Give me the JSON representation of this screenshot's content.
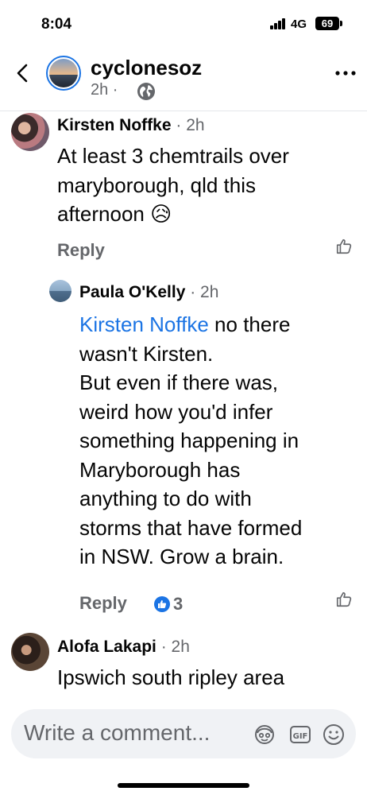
{
  "status_bar": {
    "time": "8:04",
    "network": "4G",
    "battery": "69"
  },
  "header": {
    "name": "cyclonesoz",
    "time": "2h ·",
    "icons": [
      "back-chevron-icon",
      "globe-icon",
      "more-icon"
    ]
  },
  "comments": [
    {
      "name": "Kirsten Noffke",
      "time": "· 2h",
      "lines": [
        "At least 3 chemtrails over",
        "maryborough, qld this",
        "afternoon 😥"
      ],
      "reply_label": "Reply"
    },
    {
      "name": "Paula O'Kelly",
      "time": "· 2h",
      "mention": "Kirsten Noffke",
      "first_line_rest": " no there",
      "lines": [
        "wasn't Kirsten.",
        "But even if there was,",
        "weird how you'd infer",
        "something happening in",
        "Maryborough has",
        "anything to do with",
        "storms that have formed",
        "in NSW. Grow a brain."
      ],
      "reply_label": "Reply",
      "reaction_count": "3"
    },
    {
      "name": "Alofa Lakapi",
      "time": "· 2h",
      "lines": [
        "Ipswich south ripley area"
      ]
    }
  ],
  "composer": {
    "placeholder": "Write a comment...",
    "icons": [
      "avatar-sticker-icon",
      "gif-icon",
      "emoji-icon"
    ]
  },
  "colors": {
    "accent": "#1b74e4",
    "secondary_text": "#65676b",
    "composer_bg": "#f0f2f5"
  }
}
